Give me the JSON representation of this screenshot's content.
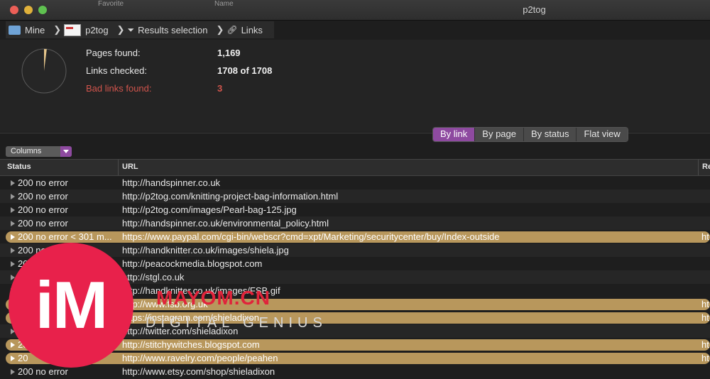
{
  "window": {
    "title": "p2tog",
    "bg_left": "Favorite",
    "bg_right": "Name"
  },
  "breadcrumbs": [
    {
      "label": "Mine",
      "icon": "folder-icon"
    },
    {
      "label": "p2tog",
      "icon": "site-thumbnail-icon"
    },
    {
      "label": "Results selection",
      "icon": "filter-icon"
    },
    {
      "label": "Links",
      "icon": "link-icon"
    }
  ],
  "stats": {
    "pages_found_label": "Pages found:",
    "pages_found_value": "1,169",
    "links_checked_label": "Links checked:",
    "links_checked_value": "1708 of 1708",
    "bad_links_label": "Bad links found:",
    "bad_links_value": "3",
    "progress_fraction": 0.02
  },
  "view_tabs": {
    "by_link": "By link",
    "by_page": "By page",
    "by_status": "By status",
    "flat_view": "Flat view",
    "active": "by_link"
  },
  "columns_button": "Columns",
  "table": {
    "headers": {
      "status": "Status",
      "url": "URL",
      "referrer": "Re"
    },
    "rows": [
      {
        "status": "200 no error",
        "url": "http://handspinner.co.uk",
        "ref": "",
        "highlight": false
      },
      {
        "status": "200 no error",
        "url": "http://p2tog.com/knitting-project-bag-information.html",
        "ref": "",
        "highlight": false
      },
      {
        "status": "200 no error",
        "url": "http://p2tog.com/images/Pearl-bag-125.jpg",
        "ref": "",
        "highlight": false
      },
      {
        "status": "200 no error",
        "url": "http://handspinner.co.uk/environmental_policy.html",
        "ref": "",
        "highlight": false
      },
      {
        "status": "200 no error < 301 m...",
        "url": "https://www.paypal.com/cgi-bin/webscr?cmd=xpt/Marketing/securitycenter/buy/Index-outside",
        "ref": "ht",
        "highlight": true
      },
      {
        "status": "200 no",
        "url": "http://handknitter.co.uk/images/shiela.jpg",
        "ref": "",
        "highlight": false
      },
      {
        "status": "20",
        "url": "http://peacockmedia.blogspot.com",
        "ref": "",
        "highlight": false
      },
      {
        "status": "",
        "url": "http://stgl.co.uk",
        "ref": "",
        "highlight": false
      },
      {
        "status": "",
        "url": "http://handknitter.co.uk/images/FSB.gif",
        "ref": "",
        "highlight": false
      },
      {
        "status": "",
        "url": "http://www.fsb.org.uk",
        "ref": "ht",
        "highlight": true
      },
      {
        "status": "",
        "url": "https://instagram.com/shieladixon",
        "ref": "ht",
        "highlight": true
      },
      {
        "status": "",
        "url": "http://twitter.com/shieladixon",
        "ref": "",
        "highlight": false
      },
      {
        "status": "20",
        "url": "http://stitchywitches.blogspot.com",
        "ref": "ht",
        "highlight": true
      },
      {
        "status": "20",
        "url": "http://www.ravelry.com/people/peahen",
        "ref": "ht",
        "highlight": true
      },
      {
        "status": "200 no error",
        "url": "http://www.etsy.com/shop/shieladixon",
        "ref": "",
        "highlight": false
      }
    ]
  },
  "watermark": {
    "logo": "iM",
    "line1": "MAYOM.CN",
    "line2": "DIGITAL GENIUS"
  }
}
